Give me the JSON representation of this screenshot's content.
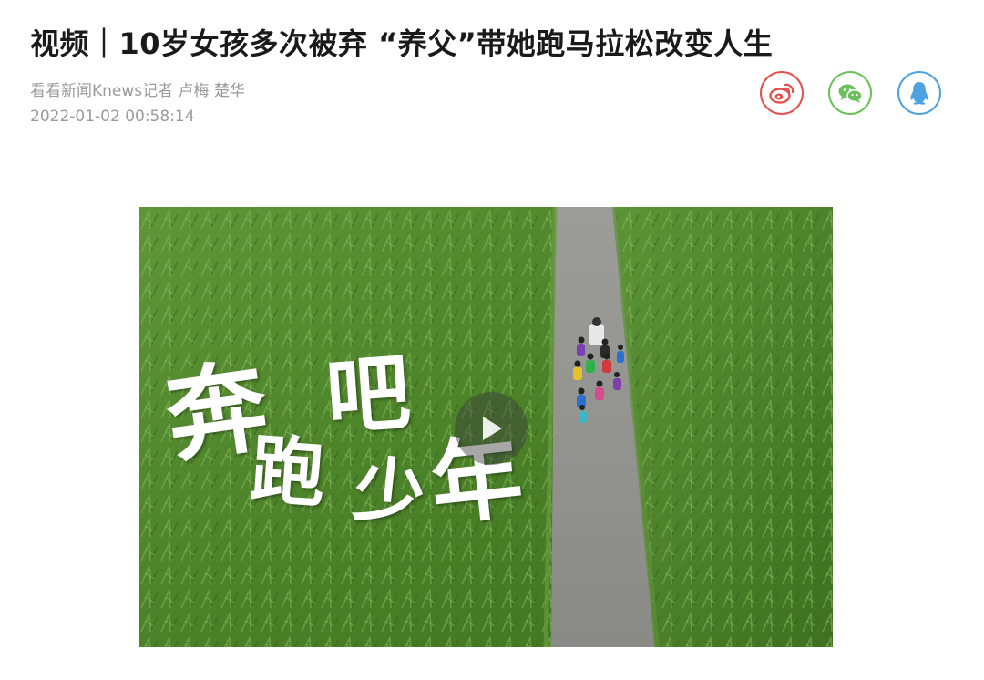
{
  "article": {
    "title": "视频｜10岁女孩多次被弃 “养父”带她跑马拉松改变人生",
    "byline": "看看新闻Knews记者 卢梅 楚华",
    "datetime": "2022-01-02 00:58:14"
  },
  "share": {
    "items": [
      {
        "name": "weibo",
        "icon": "weibo-icon",
        "color": "#e3514e"
      },
      {
        "name": "wechat",
        "icon": "wechat-icon",
        "color": "#6bc05b"
      },
      {
        "name": "qq",
        "icon": "qq-penguin-icon",
        "color": "#4fa2e0"
      }
    ]
  },
  "video": {
    "overlay_chars": [
      "奔",
      "跑",
      "吧",
      "少",
      "年"
    ],
    "play_icon": "play-icon"
  }
}
